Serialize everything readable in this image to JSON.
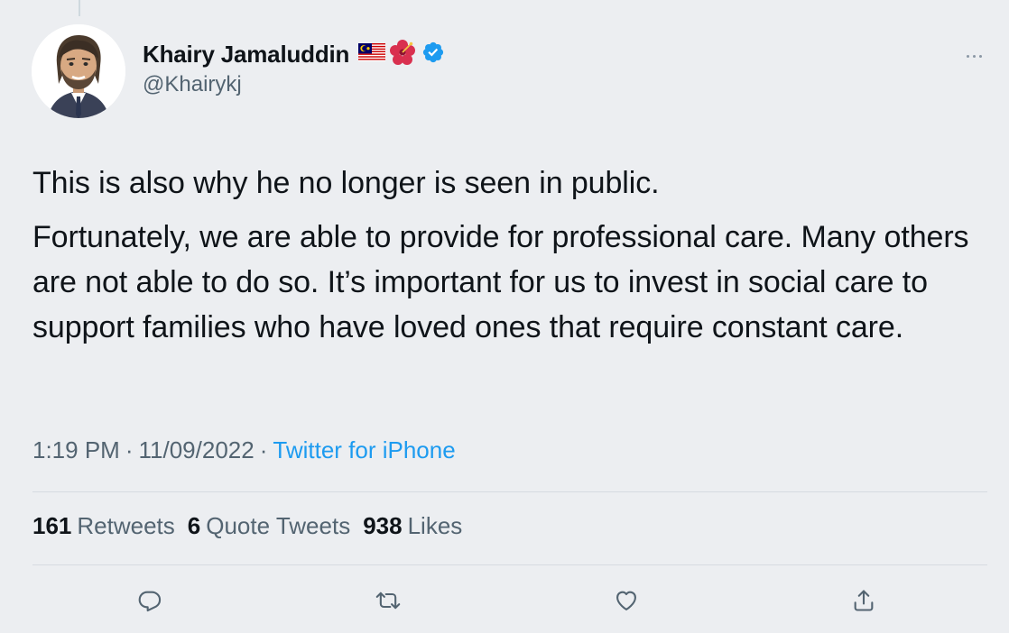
{
  "author": {
    "display_name": "Khairy Jamaluddin",
    "handle": "@Khairykj",
    "badges": [
      "malaysia-flag-icon",
      "hibiscus-icon",
      "verified-badge-icon"
    ]
  },
  "tweet": {
    "paragraphs": [
      "This is also why he no longer is seen in public.",
      "Fortunately, we are able to provide for professional care. Many others are not able to do so. It’s important for us to invest in social care to support families who have loved ones that require constant care."
    ],
    "time": "1:19 PM",
    "date": "11/09/2022",
    "separator": "·",
    "source": "Twitter for iPhone"
  },
  "stats": {
    "retweets_count": "161",
    "retweets_label": "Retweets",
    "quotes_count": "6",
    "quotes_label": "Quote Tweets",
    "likes_count": "938",
    "likes_label": "Likes"
  },
  "actions": [
    "reply-icon",
    "retweet-icon",
    "like-icon",
    "share-icon"
  ],
  "colors": {
    "background": "#eceef1",
    "text_primary": "#0f1419",
    "text_secondary": "#536471",
    "link": "#1d9bf0",
    "verified": "#1d9bf0",
    "divider": "#d6dbe0"
  }
}
